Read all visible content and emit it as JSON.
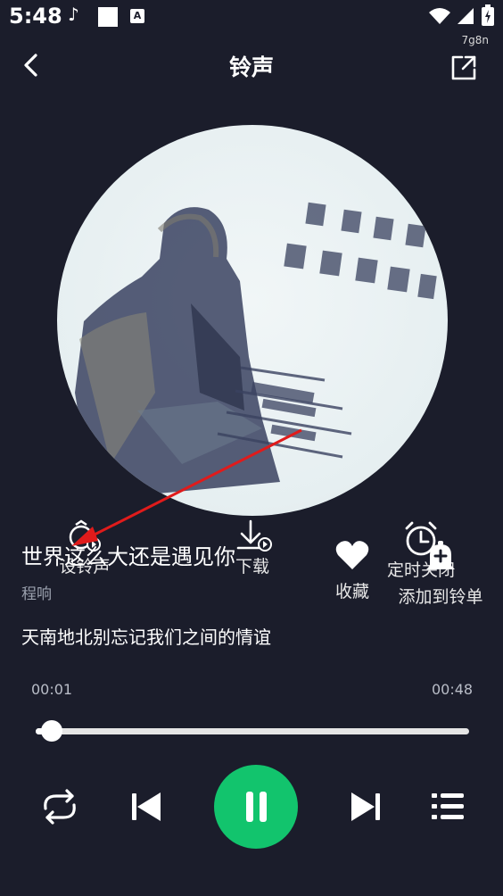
{
  "status_bar": {
    "time": "5:48",
    "note_icon": "music-note-icon",
    "a_icon_text": "A",
    "sub_label": "7g8n"
  },
  "header": {
    "title": "铃声",
    "back_icon": "chevron-left-icon",
    "share_icon": "external-link-icon"
  },
  "actions": {
    "set_ringtone": "设铃声",
    "download": "下载",
    "favorite": "收藏",
    "timer_close": "定时关闭",
    "add_to_list": "添加到铃单"
  },
  "song": {
    "title": "世界这么大还是遇见你",
    "artist": "程响",
    "lyric": "天南地北别忘记我们之间的情谊"
  },
  "playback": {
    "current_time": "00:01",
    "total_time": "00:48",
    "progress": 0.02
  },
  "controls": {
    "repeat_icon": "repeat-icon",
    "prev_icon": "skip-previous-icon",
    "play_pause_icon": "pause-icon",
    "next_icon": "skip-next-icon",
    "playlist_icon": "playlist-icon"
  },
  "colors": {
    "background": "#1b1d2b",
    "accent": "#12c46d",
    "annotation_arrow": "#e01b1b"
  }
}
